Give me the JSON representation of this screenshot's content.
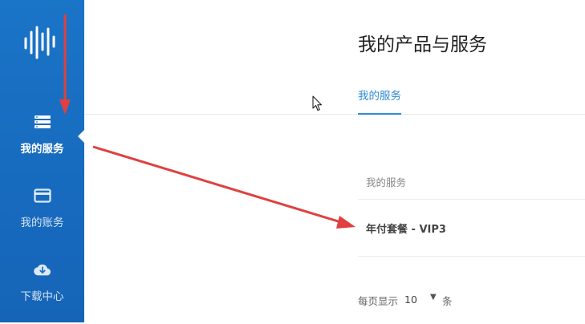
{
  "sidebar": {
    "items": [
      {
        "icon": "server-list-icon",
        "label": "我的服务",
        "active": true
      },
      {
        "icon": "credit-card-icon",
        "label": "我的账务",
        "active": false
      },
      {
        "icon": "cloud-download-icon",
        "label": "下载中心",
        "active": false
      }
    ]
  },
  "main": {
    "title": "我的产品与服务",
    "tabs": [
      {
        "label": "我的服务",
        "active": true
      }
    ],
    "table": {
      "headers": [
        "我的服务"
      ],
      "rows": [
        [
          "年付套餐 - VIP3"
        ]
      ]
    },
    "pagination": {
      "per_page_label": "每页显示",
      "per_page_value": "10",
      "unit": "条"
    }
  },
  "colors": {
    "sidebar_bg": "#1a74c7",
    "accent": "#2f8ad8",
    "annotation_arrow": "#e04040"
  }
}
